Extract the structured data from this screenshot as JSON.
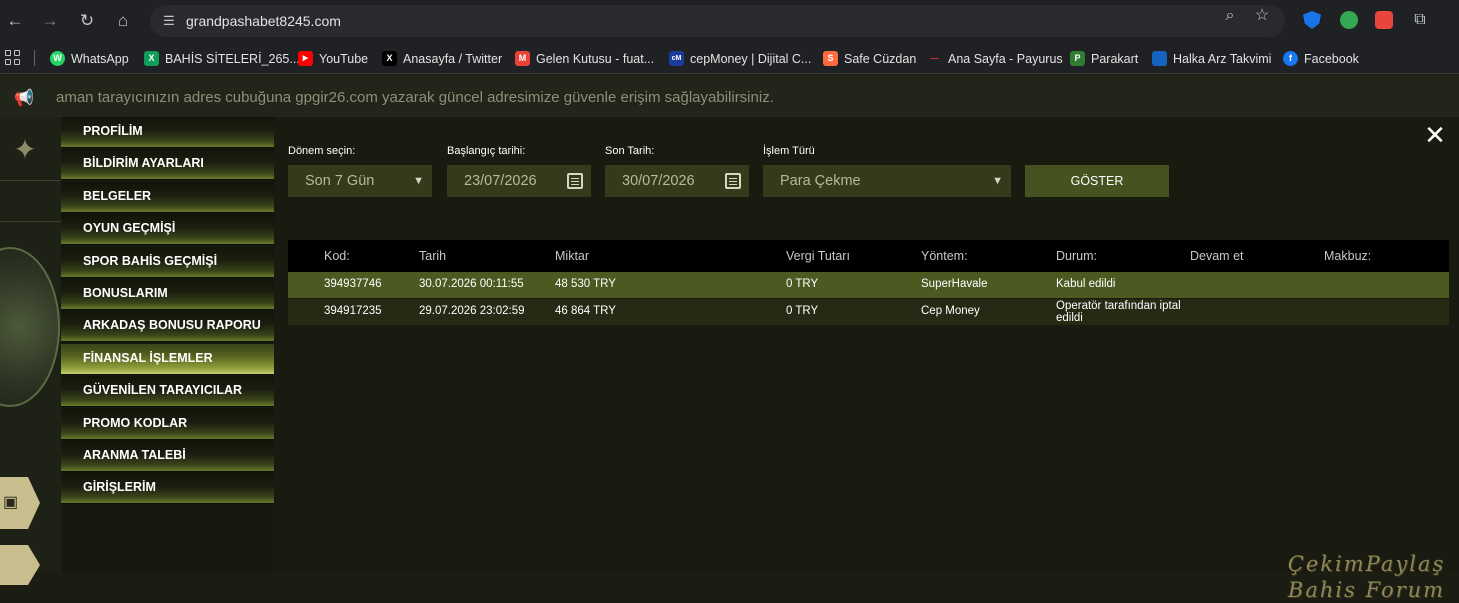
{
  "browser": {
    "url": "grandpashabet8245.com",
    "bookmarks": [
      {
        "label": "WhatsApp",
        "color": "#25d366",
        "glyph": "W"
      },
      {
        "label": "BAHİS SİTELERİ_265...",
        "color": "#0f9d58",
        "glyph": "X"
      },
      {
        "label": "YouTube",
        "color": "#ff0000",
        "glyph": "▶"
      },
      {
        "label": "Anasayfa / Twitter",
        "color": "#000000",
        "glyph": "X"
      },
      {
        "label": "Gelen Kutusu - fuat...",
        "color": "#ea4335",
        "glyph": "M"
      },
      {
        "label": "cepMoney | Dijital C...",
        "color": "#1a3a9c",
        "glyph": "cM"
      },
      {
        "label": "Safe Cüzdan",
        "color": "#ff6b3d",
        "glyph": "S"
      },
      {
        "label": "Ana Sayfa - Payurus",
        "color": "#b33",
        "glyph": "—"
      },
      {
        "label": "Parakart",
        "color": "#2e7d32",
        "glyph": "P"
      },
      {
        "label": "Halka Arz Takvimi",
        "color": "#1565c0",
        "glyph": " "
      },
      {
        "label": "Facebook",
        "color": "#1877f2",
        "glyph": "f"
      }
    ]
  },
  "announcement": "aman tarayıcınızın adres cubuğuna gpgir26.com yazarak güncel adresimize güvenle erişim sağlayabilirsiniz.",
  "menu": [
    {
      "label": "PROFİLİM",
      "active": false
    },
    {
      "label": "BİLDİRİM AYARLARI",
      "active": false
    },
    {
      "label": "BELGELER",
      "active": false
    },
    {
      "label": "OYUN GEÇMİŞİ",
      "active": false
    },
    {
      "label": "SPOR BAHİS GEÇMİŞİ",
      "active": false
    },
    {
      "label": "BONUSLARIM",
      "active": false
    },
    {
      "label": "ARKADAŞ BONUSU RAPORU",
      "active": false
    },
    {
      "label": "FİNANSAL İŞLEMLER",
      "active": true
    },
    {
      "label": "GÜVENİLEN TARAYICILAR",
      "active": false
    },
    {
      "label": "PROMO KODLAR",
      "active": false
    },
    {
      "label": "ARANMA TALEBİ",
      "active": false
    },
    {
      "label": "GİRİŞLERİM",
      "active": false
    }
  ],
  "filters": {
    "period_label": "Dönem seçin:",
    "period_value": "Son 7 Gün",
    "start_label": "Başlangıç tarihi:",
    "start_value": "23/07/2026",
    "end_label": "Son Tarih:",
    "end_value": "30/07/2026",
    "type_label": "İşlem Türü",
    "type_value": "Para Çekme",
    "show_label": "GÖSTER"
  },
  "table": {
    "headers": [
      "Kod:",
      "Tarih",
      "Miktar",
      "Vergi Tutarı",
      "Yöntem:",
      "Durum:",
      "Devam et",
      "Makbuz:"
    ],
    "rows": [
      [
        "394937746",
        "30.07.2026 00:11:55",
        "48 530 TRY",
        "0 TRY",
        "SuperHavale",
        "Kabul edildi",
        "",
        ""
      ],
      [
        "394917235",
        "29.07.2026 23:02:59",
        "46 864 TRY",
        "0 TRY",
        "Cep Money",
        "Operatör tarafından iptal edildi",
        "",
        ""
      ]
    ]
  },
  "watermark": {
    "line1": "ÇekimPaylaş",
    "line2": "Bahis Forum"
  }
}
